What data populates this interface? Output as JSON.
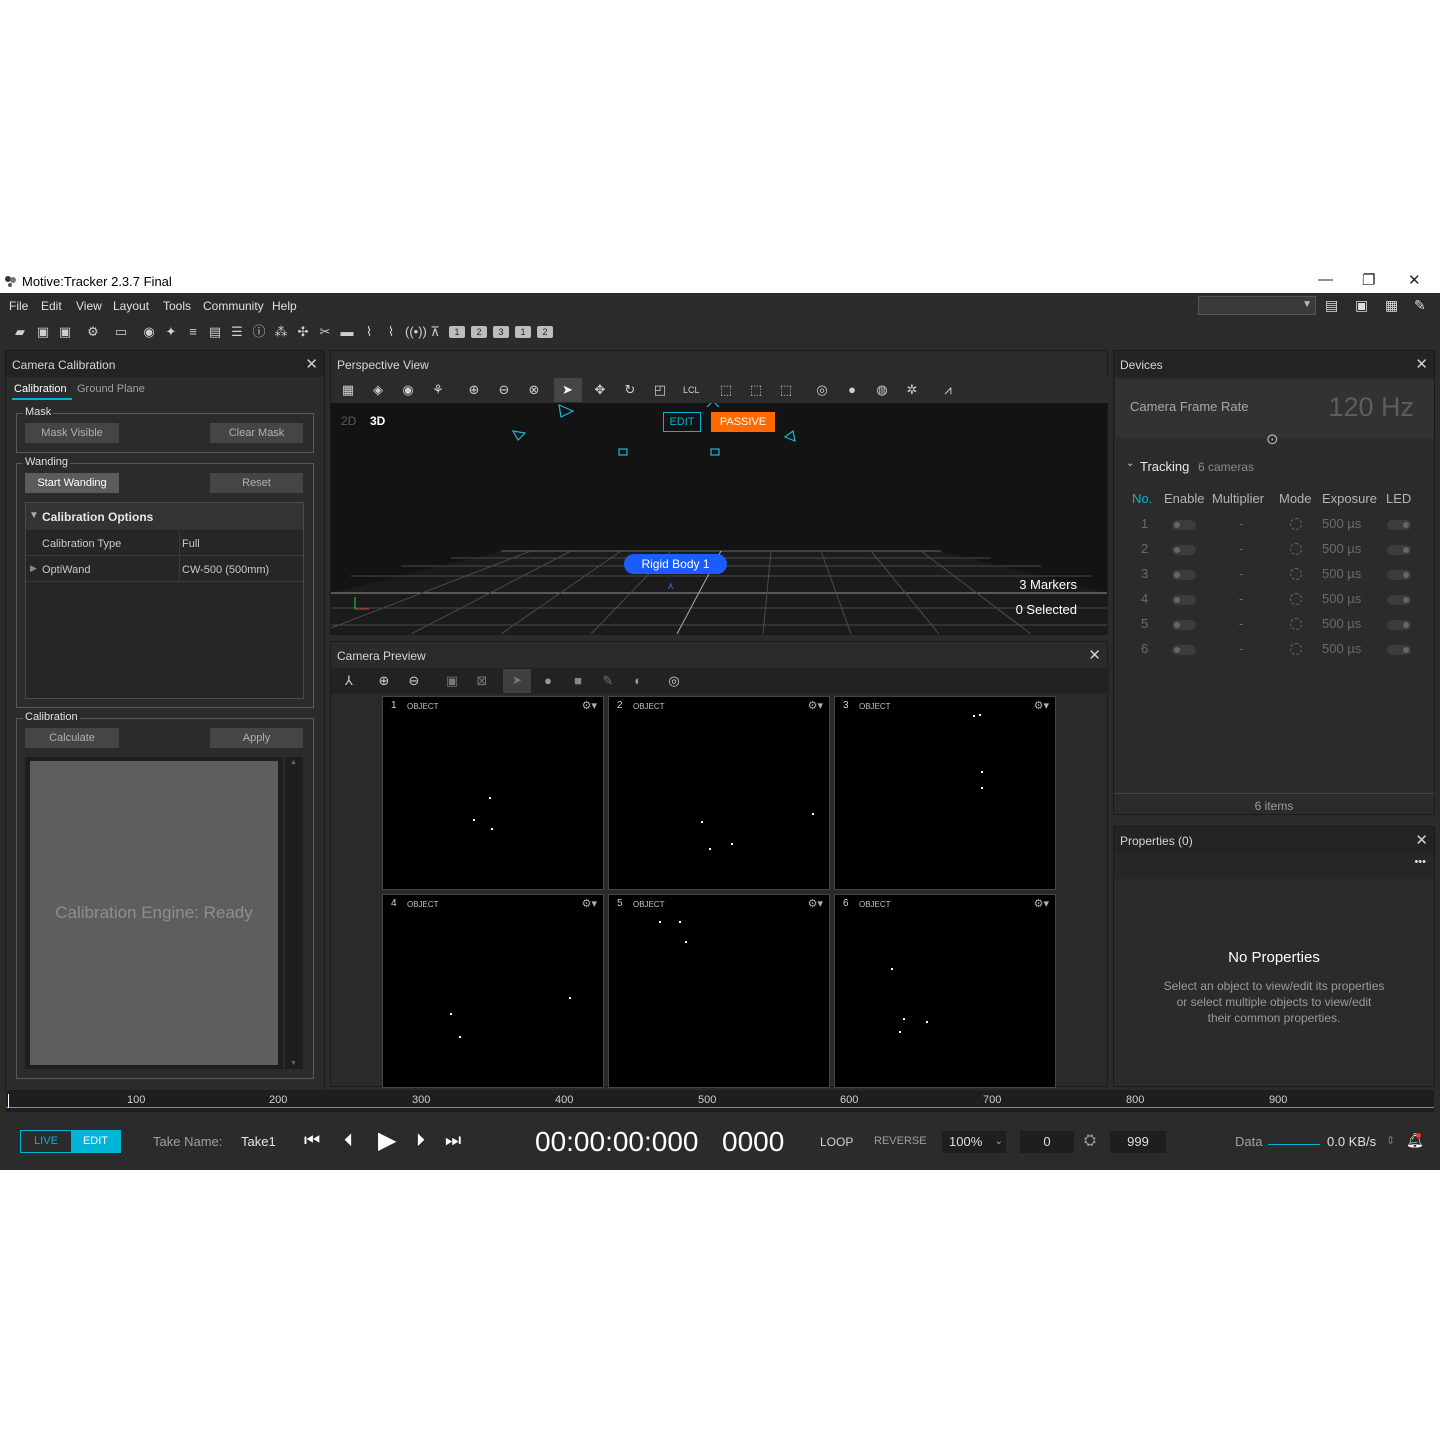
{
  "window": {
    "title": "Motive:Tracker 2.3.7 Final",
    "minimize": "—",
    "maximize": "❐",
    "close": "✕"
  },
  "menu": [
    "File",
    "Edit",
    "View",
    "Layout",
    "Tools",
    "Community",
    "Help"
  ],
  "calibration_panel": {
    "title": "Camera Calibration",
    "tabs": [
      "Calibration",
      "Ground Plane"
    ],
    "mask": {
      "label": "Mask",
      "mask_visible": "Mask Visible",
      "clear_mask": "Clear Mask"
    },
    "wanding": {
      "label": "Wanding",
      "start": "Start Wanding",
      "reset": "Reset"
    },
    "options": {
      "header": "Calibration Options",
      "rows": [
        {
          "name": "Calibration Type",
          "value": "Full"
        },
        {
          "name": "OptiWand",
          "value": "CW-500 (500mm)"
        }
      ]
    },
    "calibration": {
      "label": "Calibration",
      "calculate": "Calculate",
      "apply": "Apply",
      "status": "Calibration Engine: Ready"
    }
  },
  "perspective": {
    "title": "Perspective View",
    "mode_2d": "2D",
    "mode_3d": "3D",
    "lcl": "LCL",
    "edit_badge": "EDIT",
    "passive_badge": "PASSIVE",
    "rigid_body": "Rigid Body 1",
    "markers": "3 Markers",
    "selected": "0 Selected"
  },
  "camera_preview": {
    "title": "Camera Preview",
    "cams": [
      {
        "num": "1",
        "mode": "OBJECT"
      },
      {
        "num": "2",
        "mode": "OBJECT"
      },
      {
        "num": "3",
        "mode": "OBJECT"
      },
      {
        "num": "4",
        "mode": "OBJECT"
      },
      {
        "num": "5",
        "mode": "OBJECT"
      },
      {
        "num": "6",
        "mode": "OBJECT"
      }
    ]
  },
  "devices": {
    "title": "Devices",
    "frame_rate_label": "Camera Frame Rate",
    "frame_rate_value": "120 Hz",
    "tracking_label": "Tracking",
    "tracking_count": "6 cameras",
    "columns": [
      "No.",
      "Enable",
      "Multiplier",
      "Mode",
      "Exposure",
      "LED"
    ],
    "rows": [
      {
        "no": "1",
        "mult": "-",
        "exposure": "500 µs"
      },
      {
        "no": "2",
        "mult": "-",
        "exposure": "500 µs"
      },
      {
        "no": "3",
        "mult": "-",
        "exposure": "500 µs"
      },
      {
        "no": "4",
        "mult": "-",
        "exposure": "500 µs"
      },
      {
        "no": "5",
        "mult": "-",
        "exposure": "500 µs"
      },
      {
        "no": "6",
        "mult": "-",
        "exposure": "500 µs"
      }
    ],
    "footer": "6 items"
  },
  "properties": {
    "title": "Properties (0)",
    "more": "•••",
    "heading": "No Properties",
    "line1": "Select an object to view/edit its properties",
    "line2": "or select multiple objects to view/edit",
    "line3": "their common properties."
  },
  "timeline": {
    "ticks": [
      "100",
      "200",
      "300",
      "400",
      "500",
      "600",
      "700",
      "800",
      "900"
    ]
  },
  "transport": {
    "live": "LIVE",
    "edit": "EDIT",
    "take_label": "Take Name:",
    "take_value": "Take1",
    "timecode": "00:00:00:000",
    "frame": "0000",
    "loop": "LOOP",
    "reverse": "REVERSE",
    "speed": "100%",
    "start": "0",
    "end": "999",
    "data_label": "Data",
    "data_value": "0.0 KB/s"
  },
  "colors": {
    "accent": "#00b4d8",
    "passive": "#ff6a00",
    "rigid": "#1a5cff",
    "bg": "#2b2b2b"
  }
}
